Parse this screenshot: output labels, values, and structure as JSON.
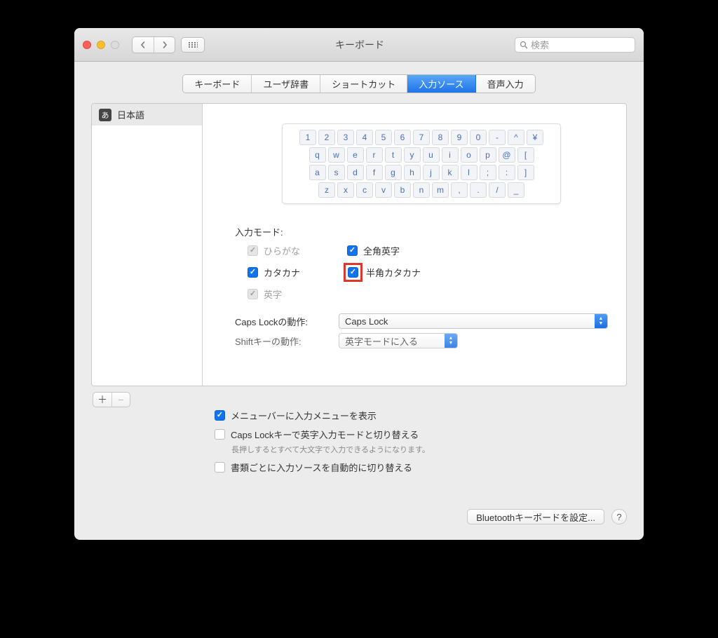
{
  "window": {
    "title": "キーボード"
  },
  "search": {
    "placeholder": "検索"
  },
  "tabs": [
    "キーボード",
    "ユーザ辞書",
    "ショートカット",
    "入力ソース",
    "音声入力"
  ],
  "selected_tab": 3,
  "sidebar": {
    "lang_icon": "あ",
    "lang_label": "日本語"
  },
  "keyboard_rows": [
    [
      "1",
      "2",
      "3",
      "4",
      "5",
      "6",
      "7",
      "8",
      "9",
      "0",
      "-",
      "^",
      "¥"
    ],
    [
      "q",
      "w",
      "e",
      "r",
      "t",
      "y",
      "u",
      "i",
      "o",
      "p",
      "@",
      "["
    ],
    [
      "a",
      "s",
      "d",
      "f",
      "g",
      "h",
      "j",
      "k",
      "l",
      ";",
      ":",
      "]"
    ],
    [
      "z",
      "x",
      "c",
      "v",
      "b",
      "n",
      "m",
      ",",
      ".",
      "/",
      "_"
    ]
  ],
  "input_mode": {
    "label": "入力モード:",
    "hiragana": "ひらがな",
    "katakana": "カタカナ",
    "eiji": "英字",
    "zenkaku_eiji": "全角英字",
    "hankaku_katakana": "半角カタカナ"
  },
  "capslock": {
    "label": "Caps Lockの動作:",
    "value": "Caps Lock"
  },
  "shift": {
    "label": "Shiftキーの動作:",
    "value": "英字モードに入る"
  },
  "bottom": {
    "show_input_menu": "メニューバーに入力メニューを表示",
    "capslock_switch": "Caps Lockキーで英字入力モードと切り替える",
    "capslock_hint": "長押しするとすべて大文字で入力できるようになります。",
    "per_document": "書類ごとに入力ソースを自動的に切り替える"
  },
  "footer": {
    "bluetooth": "Bluetoothキーボードを設定...",
    "help": "?"
  },
  "buttons": {
    "add": "＋",
    "remove": "−"
  }
}
